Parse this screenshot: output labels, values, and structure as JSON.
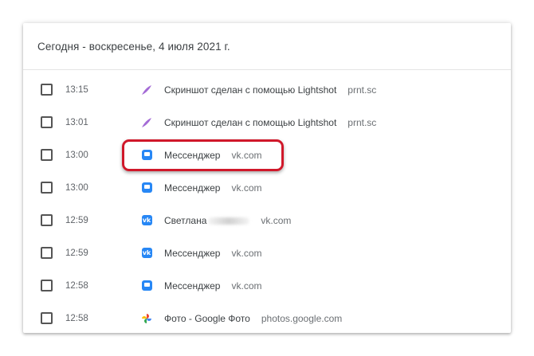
{
  "header": {
    "date_title": "Сегодня - воскресенье, 4 июля 2021 г."
  },
  "colors": {
    "accent_vk": "#2787f5",
    "highlight": "#d0182a"
  },
  "rows": [
    {
      "time": "13:15",
      "title": "Скриншот сделан с помощью Lightshot",
      "domain": "prnt.sc",
      "icon": "lightshot-feather-icon"
    },
    {
      "time": "13:01",
      "title": "Скриншот сделан с помощью Lightshot",
      "domain": "prnt.sc",
      "icon": "lightshot-feather-icon"
    },
    {
      "time": "13:00",
      "title": "Мессенджер",
      "domain": "vk.com",
      "icon": "vk-messenger-icon"
    },
    {
      "time": "13:00",
      "title": "Мессенджер",
      "domain": "vk.com",
      "icon": "vk-messenger-icon"
    },
    {
      "time": "12:59",
      "title": "Светлана",
      "domain": "vk.com",
      "icon": "vk-logo-icon"
    },
    {
      "time": "12:59",
      "title": "Мессенджер",
      "domain": "vk.com",
      "icon": "vk-logo-icon"
    },
    {
      "time": "12:58",
      "title": "Мессенджер",
      "domain": "vk.com",
      "icon": "vk-messenger-icon"
    },
    {
      "time": "12:58",
      "title": "Фото - Google Фото",
      "domain": "photos.google.com",
      "icon": "google-photos-icon"
    }
  ],
  "vk_glyph": "vk"
}
